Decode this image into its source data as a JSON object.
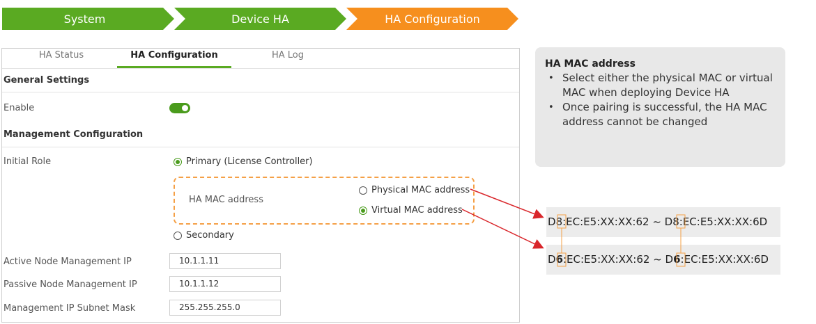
{
  "breadcrumb": [
    "System",
    "Device HA",
    "HA Configuration"
  ],
  "tabs": [
    "HA Status",
    "HA Configuration",
    "HA Log"
  ],
  "sections": {
    "general": "General Settings",
    "management": "Management Configuration"
  },
  "enable": {
    "label": "Enable",
    "value": true
  },
  "initial_role": {
    "label": "Initial Role",
    "primary": "Primary (License Controller)",
    "secondary": "Secondary",
    "selected": "primary"
  },
  "ha_mac": {
    "label": "HA MAC address",
    "physical": "Physical MAC address",
    "virtual": "Virtual MAC address",
    "selected": "virtual"
  },
  "fields": [
    {
      "label": "Active Node Management IP",
      "value": "10.1.1.11"
    },
    {
      "label": "Passive Node Management IP",
      "value": "10.1.1.12"
    },
    {
      "label": "Management IP Subnet Mask",
      "value": "255.255.255.0"
    }
  ],
  "info": {
    "title": "HA MAC address",
    "bullets": [
      "Select either the physical MAC or virtual MAC when deploying Device HA",
      "Once pairing is successful, the HA MAC address cannot be changed"
    ]
  },
  "examples": {
    "physical": {
      "start_prefix": "D",
      "start_hl": "8",
      "start_rest": ":EC:E5:XX:XX:62",
      "sep": " ~ ",
      "end_prefix": "D",
      "end_hl": "8",
      "end_rest": ":EC:E5:XX:XX:6D"
    },
    "virtual": {
      "start_prefix": "D",
      "start_hl": "6",
      "start_rest": ":EC:E5:XX:XX:62",
      "sep": " ~ ",
      "end_prefix": "D",
      "end_hl": "6",
      "end_rest": ":EC:E5:XX:XX:6D"
    }
  },
  "colors": {
    "green": "#5aaa22",
    "orange": "#f68f1e",
    "arrow": "#d9262b"
  }
}
